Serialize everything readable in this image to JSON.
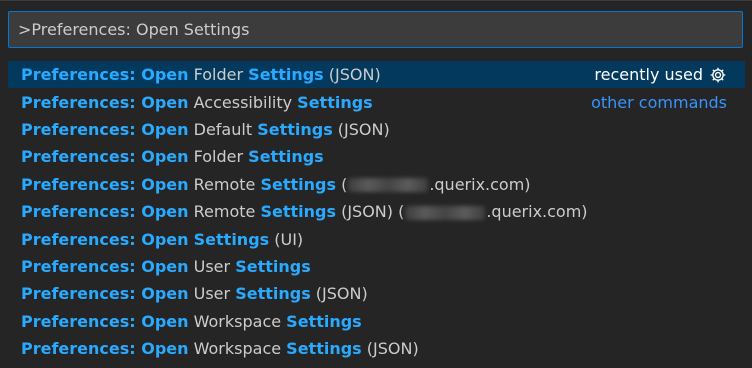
{
  "input": {
    "value": ">Preferences: Open Settings"
  },
  "items": [
    {
      "prefix": "Preferences: Open",
      "a": " Folder ",
      "b": "Settings",
      "c": " (JSON)",
      "right": "recently used"
    },
    {
      "prefix": "Preferences: Open",
      "a": " Accessibility ",
      "b": "Settings",
      "c": "",
      "right": "other commands"
    },
    {
      "prefix": "Preferences: Open",
      "a": " Default ",
      "b": "Settings",
      "c": " (JSON)"
    },
    {
      "prefix": "Preferences: Open",
      "a": " Folder ",
      "b": "Settings",
      "c": ""
    },
    {
      "prefix": "Preferences: Open",
      "a": " Remote ",
      "b": "Settings",
      "c": " (",
      "d": ".querix.com)"
    },
    {
      "prefix": "Preferences: Open",
      "a": " Remote ",
      "b": "Settings",
      "c": " (JSON) (",
      "d": ".querix.com)"
    },
    {
      "prefix": "Preferences: Open",
      "a": " ",
      "b": "Settings",
      "c": " (UI)"
    },
    {
      "prefix": "Preferences: Open",
      "a": " User ",
      "b": "Settings",
      "c": ""
    },
    {
      "prefix": "Preferences: Open",
      "a": " User ",
      "b": "Settings",
      "c": " (JSON)"
    },
    {
      "prefix": "Preferences: Open",
      "a": " Workspace ",
      "b": "Settings",
      "c": ""
    },
    {
      "prefix": "Preferences: Open",
      "a": " Workspace ",
      "b": "Settings",
      "c": " (JSON)"
    }
  ],
  "icons": {
    "configure": "gear-icon"
  },
  "colors": {
    "highlight": "#2aaaff",
    "selected_bg": "#04395e",
    "focus_border": "#0078d4",
    "link": "#3794ff"
  }
}
